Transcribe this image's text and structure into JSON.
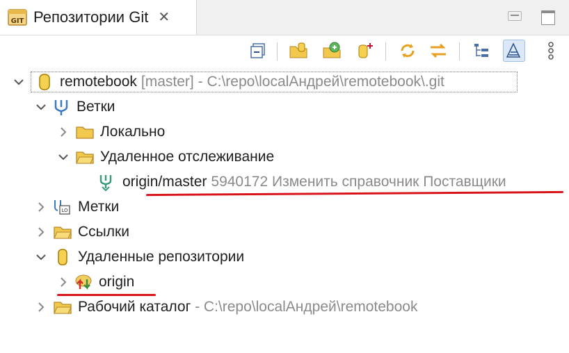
{
  "tab": {
    "title": "Репозитории Git",
    "close_glyph": "✕",
    "icon_text": "GIT"
  },
  "toolbar": {
    "buttons": [
      "collapse-all-icon",
      "add-existing-repo-icon",
      "clone-repo-icon",
      "create-repo-icon",
      "link-with-selection-icon",
      "fetch-push-icon",
      "hierarchical-layout-icon",
      "link-editor-icon",
      "view-menu-icon"
    ]
  },
  "tree": {
    "repo": {
      "name": "remotebook",
      "branch": "[master]",
      "sep": " - ",
      "path": "C:\\repo\\localАндрей\\remotebook\\.git"
    },
    "branches": {
      "label": "Ветки"
    },
    "local": {
      "label": "Локально"
    },
    "remote_tracking": {
      "label": "Удаленное отслеживание"
    },
    "origin_master": {
      "name": "origin/master",
      "commit": "5940172 Изменить справочник Поставщики"
    },
    "tags": {
      "label": "Метки"
    },
    "refs": {
      "label": "Ссылки"
    },
    "remotes": {
      "label": "Удаленные репозитории"
    },
    "origin": {
      "label": "origin"
    },
    "workdir": {
      "label": "Рабочий каталог",
      "sep": " - ",
      "path": "C:\\repo\\localАндрей\\remotebook"
    }
  },
  "colors": {
    "annotation_red": "#d8141a",
    "decoration_gray": "#8a8a8a",
    "folder_yellow": "#f2c94c"
  }
}
